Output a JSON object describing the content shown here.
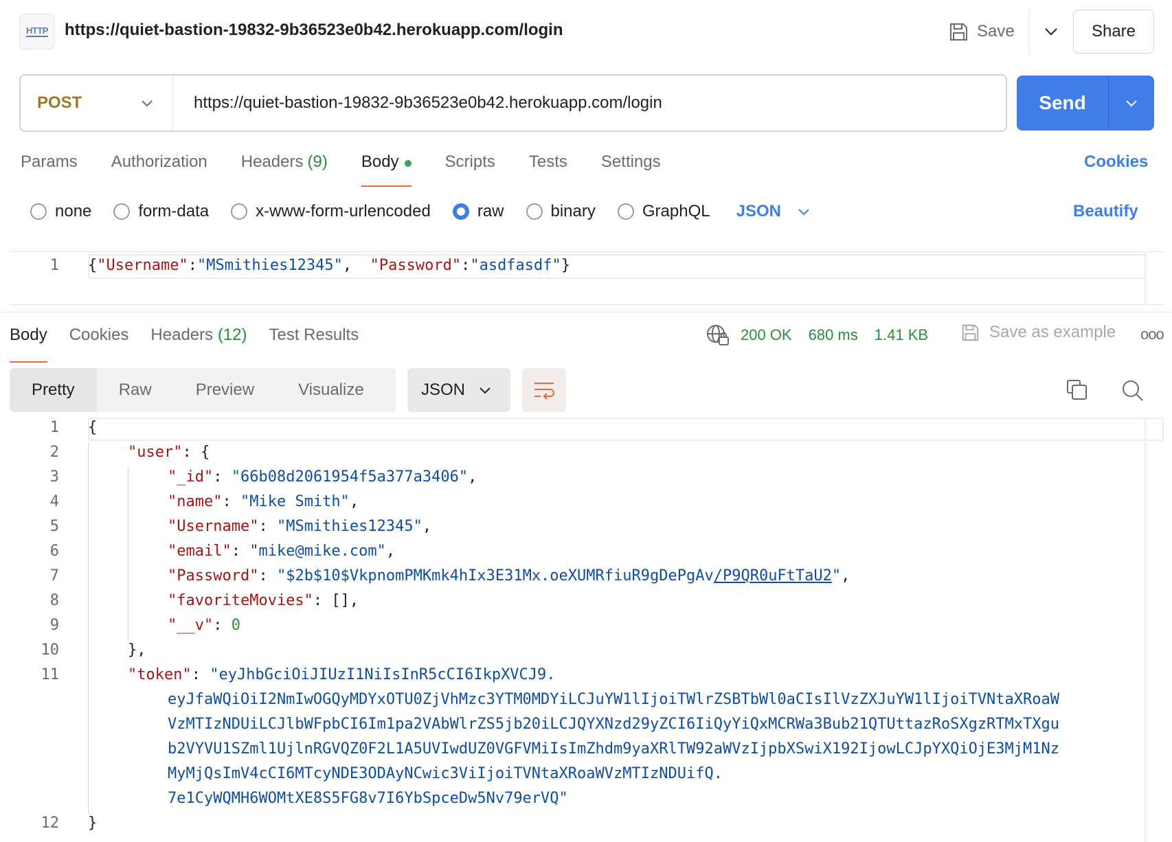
{
  "header": {
    "icon_label": "HTTP",
    "title": "https://quiet-bastion-19832-9b36523e0b42.herokuapp.com/login",
    "save_label": "Save",
    "share_label": "Share"
  },
  "request": {
    "method": "POST",
    "url": "https://quiet-bastion-19832-9b36523e0b42.herokuapp.com/login",
    "send_label": "Send",
    "tabs": [
      {
        "label": "Params",
        "count": ""
      },
      {
        "label": "Authorization",
        "count": ""
      },
      {
        "label": "Headers",
        "count": "(9)"
      },
      {
        "label": "Body",
        "count": ""
      },
      {
        "label": "Scripts",
        "count": ""
      },
      {
        "label": "Tests",
        "count": ""
      },
      {
        "label": "Settings",
        "count": ""
      }
    ],
    "active_tab": "Body",
    "cookies_label": "Cookies",
    "body_types": [
      "none",
      "form-data",
      "x-www-form-urlencoded",
      "raw",
      "binary",
      "GraphQL"
    ],
    "selected_body_type": "raw",
    "raw_format": "JSON",
    "beautify_label": "Beautify",
    "body_line_number": "1",
    "body_parts": {
      "open": "{",
      "k1": "\"Username\"",
      "colon": ":",
      "v1": "\"MSmithies12345\"",
      "comma": ",",
      "k2": "\"Password\"",
      "v2": "\"asdfasdf\"",
      "close": "}"
    }
  },
  "response": {
    "tabs": [
      {
        "label": "Body",
        "count": ""
      },
      {
        "label": "Cookies",
        "count": ""
      },
      {
        "label": "Headers",
        "count": "(12)"
      },
      {
        "label": "Test Results",
        "count": ""
      }
    ],
    "active_tab": "Body",
    "status": "200 OK",
    "time": "680 ms",
    "size": "1.41 KB",
    "save_example_label": "Save as example",
    "more_label": "ooo",
    "view_modes": [
      "Pretty",
      "Raw",
      "Preview",
      "Visualize"
    ],
    "active_view": "Pretty",
    "format": "JSON",
    "lines": [
      {
        "no": "1",
        "indent": 0,
        "tokens": [
          {
            "t": "p",
            "v": "{"
          }
        ]
      },
      {
        "no": "2",
        "indent": 1,
        "tokens": [
          {
            "t": "k",
            "v": "\"user\""
          },
          {
            "t": "p",
            "v": ": {"
          }
        ]
      },
      {
        "no": "3",
        "indent": 2,
        "tokens": [
          {
            "t": "k",
            "v": "\"_id\""
          },
          {
            "t": "p",
            "v": ": "
          },
          {
            "t": "s",
            "v": "\"66b08d2061954f5a377a3406\""
          },
          {
            "t": "p",
            "v": ","
          }
        ]
      },
      {
        "no": "4",
        "indent": 2,
        "tokens": [
          {
            "t": "k",
            "v": "\"name\""
          },
          {
            "t": "p",
            "v": ": "
          },
          {
            "t": "s",
            "v": "\"Mike Smith\""
          },
          {
            "t": "p",
            "v": ","
          }
        ]
      },
      {
        "no": "5",
        "indent": 2,
        "tokens": [
          {
            "t": "k",
            "v": "\"Username\""
          },
          {
            "t": "p",
            "v": ": "
          },
          {
            "t": "s",
            "v": "\"MSmithies12345\""
          },
          {
            "t": "p",
            "v": ","
          }
        ]
      },
      {
        "no": "6",
        "indent": 2,
        "tokens": [
          {
            "t": "k",
            "v": "\"email\""
          },
          {
            "t": "p",
            "v": ": "
          },
          {
            "t": "s",
            "v": "\"mike@mike.com\""
          },
          {
            "t": "p",
            "v": ","
          }
        ]
      },
      {
        "no": "7",
        "indent": 2,
        "tokens": [
          {
            "t": "k",
            "v": "\"Password\""
          },
          {
            "t": "p",
            "v": ": "
          },
          {
            "t": "s",
            "v": "\"$2b$10$VkpnomPMKmk4hIx3E31Mx.oeXUMRfiuR9gDePgAv"
          },
          {
            "t": "u",
            "v": "/P9QR0uFtTaU2"
          },
          {
            "t": "s",
            "v": "\""
          },
          {
            "t": "p",
            "v": ","
          }
        ]
      },
      {
        "no": "8",
        "indent": 2,
        "tokens": [
          {
            "t": "k",
            "v": "\"favoriteMovies\""
          },
          {
            "t": "p",
            "v": ": [],"
          }
        ]
      },
      {
        "no": "9",
        "indent": 2,
        "tokens": [
          {
            "t": "k",
            "v": "\"__v\""
          },
          {
            "t": "p",
            "v": ": "
          },
          {
            "t": "n",
            "v": "0"
          }
        ]
      },
      {
        "no": "10",
        "indent": 1,
        "tokens": [
          {
            "t": "p",
            "v": "},"
          }
        ]
      },
      {
        "no": "11",
        "indent": 1,
        "tokens": [
          {
            "t": "k",
            "v": "\"token\""
          },
          {
            "t": "p",
            "v": ": "
          },
          {
            "t": "s",
            "v": "\"eyJhbGciOiJIUzI1NiIsInR5cCI6IkpXVCJ9."
          }
        ]
      },
      {
        "no": "",
        "indent": 2,
        "tokens": [
          {
            "t": "s",
            "v": "eyJfaWQiOiI2NmIwOGQyMDYxOTU0ZjVhMzc3YTM0MDYiLCJuYW1lIjoiTWlrZSBTbWl0aCIsIlVzZXJuYW1lIjoiTVNtaXRoaW"
          }
        ]
      },
      {
        "no": "",
        "indent": 2,
        "tokens": [
          {
            "t": "s",
            "v": "VzMTIzNDUiLCJlbWFpbCI6Im1pa2VAbWlrZS5jb20iLCJQYXNzd29yZCI6IiQyYiQxMCRWa3Bub21QTUttazRoSXgzRTMxTXgu"
          }
        ]
      },
      {
        "no": "",
        "indent": 2,
        "tokens": [
          {
            "t": "s",
            "v": "b2VYVU1SZml1UjlnRGVQZ0F2L1A5UVIwdUZ0VGFVMiIsImZhdm9yaXRlTW92aWVzIjpbXSwiX192IjowLCJpYXQiOjE3MjM1Nz"
          }
        ]
      },
      {
        "no": "",
        "indent": 2,
        "tokens": [
          {
            "t": "s",
            "v": "MyMjQsImV4cCI6MTcyNDE3ODAyNCwic3ViIjoiTVNtaXRoaWVzMTIzNDUifQ."
          }
        ]
      },
      {
        "no": "",
        "indent": 2,
        "tokens": [
          {
            "t": "s",
            "v": "7e1CyWQMH6WOMtXE8S5FG8v7I6YbSpceDw5Nv79erVQ\""
          }
        ]
      },
      {
        "no": "12",
        "indent": 0,
        "tokens": [
          {
            "t": "p",
            "v": "}"
          }
        ]
      }
    ]
  },
  "colors": {
    "accent": "#3f7ee8",
    "tab_underline": "#e8683d",
    "status_green": "#2f8a3a",
    "json_key": "#a31515",
    "json_string": "#0f4d9f",
    "method_post": "#9a7a2b"
  }
}
